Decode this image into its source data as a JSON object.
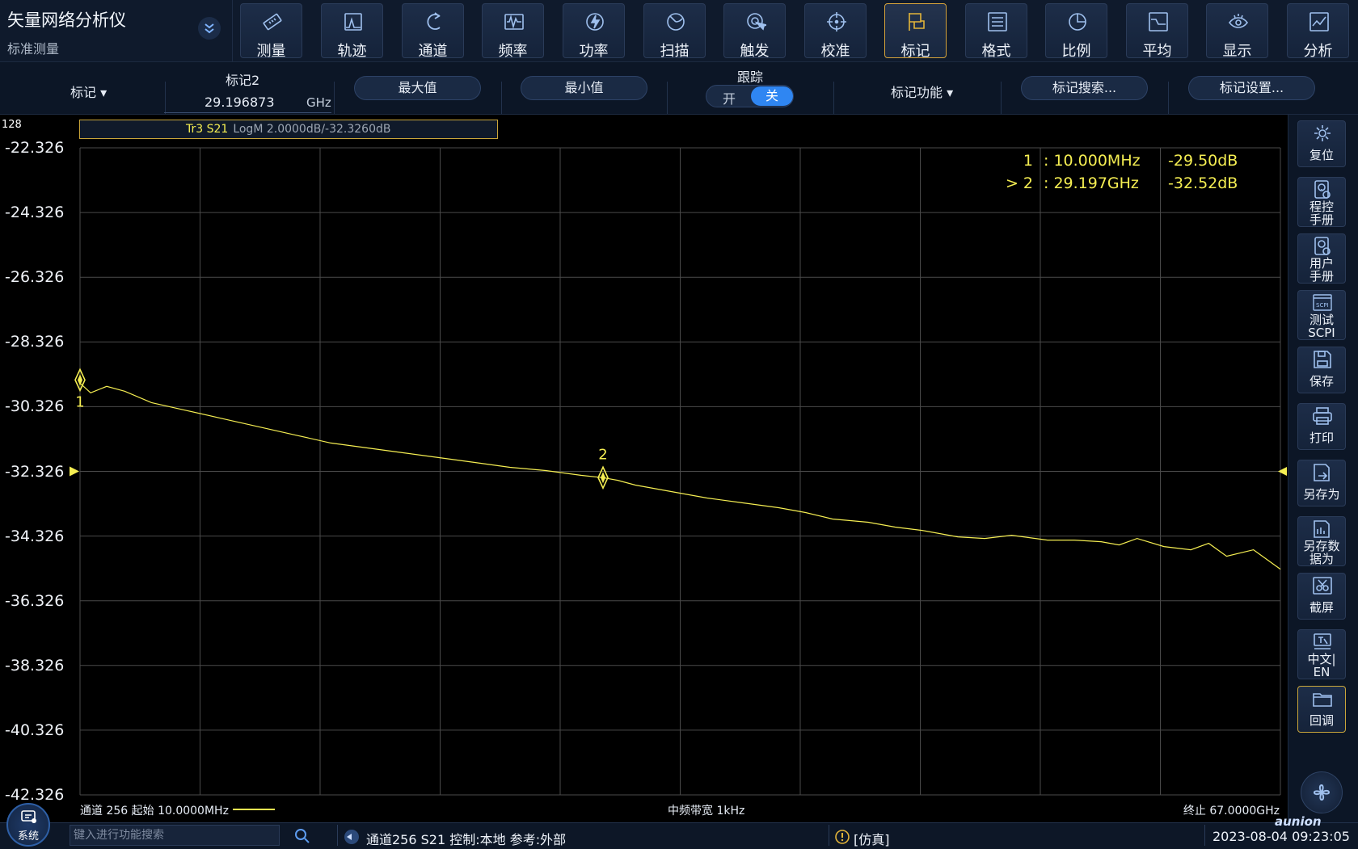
{
  "app": {
    "title": "矢量网络分析仪",
    "subtitle": "标准测量",
    "expand_icon": "double-chevron-down-icon"
  },
  "toolbar": [
    {
      "label": "测量",
      "icon": "ruler-icon"
    },
    {
      "label": "轨迹",
      "icon": "trace-icon"
    },
    {
      "label": "通道",
      "icon": "channel-icon"
    },
    {
      "label": "频率",
      "icon": "frequency-icon"
    },
    {
      "label": "功率",
      "icon": "power-icon"
    },
    {
      "label": "扫描",
      "icon": "sweep-icon"
    },
    {
      "label": "触发",
      "icon": "trigger-icon"
    },
    {
      "label": "校准",
      "icon": "calibration-icon"
    },
    {
      "label": "标记",
      "icon": "marker-flag-icon",
      "active": true
    },
    {
      "label": "格式",
      "icon": "format-icon"
    },
    {
      "label": "比例",
      "icon": "scale-icon"
    },
    {
      "label": "平均",
      "icon": "average-icon"
    },
    {
      "label": "显示",
      "icon": "display-eye-icon"
    },
    {
      "label": "分析",
      "icon": "analysis-icon"
    }
  ],
  "softkeys": {
    "marker_dropdown": "标记",
    "active_marker_label": "标记2",
    "active_marker_value": "29.196873",
    "active_marker_unit": "GHz",
    "max_button": "最大值",
    "min_button": "最小值",
    "tracking_label": "跟踪",
    "tracking_on": "开",
    "tracking_off": "关",
    "marker_function_dropdown": "标记功能",
    "marker_search_button": "标记搜索...",
    "marker_settings_button": "标记设置..."
  },
  "plot": {
    "channel_number": "128",
    "trace_name": "Tr3 S21",
    "trace_info": "LogM 2.0000dB/-32.3260dB",
    "footer_left": "通道 256 起始 10.0000MHz",
    "footer_center": "中频带宽 1kHz",
    "footer_right": "终止 67.0000GHz",
    "marker_table": [
      {
        "id": "1",
        "freq": ": 10.000MHz",
        "value": "-29.50dB"
      },
      {
        "id": "> 2",
        "freq": ": 29.197GHz",
        "value": "-32.52dB"
      }
    ],
    "trace_color": "#f5ee52"
  },
  "chart_data": {
    "type": "line",
    "x_unit": "GHz",
    "xlim": [
      0.01,
      67.0
    ],
    "ylim": [
      -42.326,
      -22.326
    ],
    "y_ticks": [
      "-22.326",
      "-24.326",
      "-26.326",
      "-28.326",
      "-30.326",
      "-32.326",
      "-34.326",
      "-36.326",
      "-38.326",
      "-40.326",
      "-42.326"
    ],
    "reference_level": -32.326,
    "grid": true,
    "series": [
      {
        "name": "Tr3 S21",
        "x": [
          0.01,
          0.6,
          1.5,
          2.5,
          4.0,
          6.0,
          8.0,
          10.0,
          12.0,
          14.0,
          16.0,
          18.0,
          20.0,
          22.0,
          24.0,
          26.0,
          28.0,
          29.197,
          30.0,
          31.0,
          33.0,
          35.0,
          37.0,
          39.0,
          40.5,
          42.0,
          44.0,
          45.5,
          47.0,
          49.0,
          50.5,
          52.0,
          54.0,
          55.5,
          57.0,
          58.0,
          59.0,
          60.5,
          62.0,
          63.0,
          64.0,
          65.5,
          67.0
        ],
        "y": [
          -29.6,
          -29.9,
          -29.7,
          -29.85,
          -30.2,
          -30.45,
          -30.7,
          -30.95,
          -31.2,
          -31.45,
          -31.6,
          -31.75,
          -31.9,
          -32.05,
          -32.2,
          -32.3,
          -32.45,
          -32.52,
          -32.6,
          -32.75,
          -32.95,
          -33.15,
          -33.3,
          -33.45,
          -33.6,
          -33.8,
          -33.9,
          -34.05,
          -34.15,
          -34.35,
          -34.4,
          -34.3,
          -34.45,
          -34.45,
          -34.5,
          -34.6,
          -34.4,
          -34.65,
          -34.75,
          -34.55,
          -34.95,
          -34.75,
          -35.35
        ]
      }
    ],
    "markers": [
      {
        "label": "1",
        "x": 0.01,
        "y": -29.5
      },
      {
        "label": "2",
        "x": 29.197,
        "y": -32.52
      }
    ]
  },
  "right_panel": [
    {
      "label": "复位",
      "icon": "reset-gear-icon"
    },
    {
      "label": "程控\n手册",
      "icon": "programming-manual-icon"
    },
    {
      "label": "用户\n手册",
      "icon": "user-manual-icon"
    },
    {
      "label": "测试\nSCPI",
      "icon": "scpi-test-icon"
    },
    {
      "label": "保存",
      "icon": "save-icon"
    },
    {
      "label": "打印",
      "icon": "print-icon"
    },
    {
      "label": "另存为",
      "icon": "save-as-icon"
    },
    {
      "label": "另存数\n据为",
      "icon": "save-data-as-icon"
    },
    {
      "label": "截屏",
      "icon": "screenshot-icon"
    },
    {
      "label": "中文|\nEN",
      "icon": "language-icon"
    },
    {
      "label": "回调",
      "icon": "recall-folder-icon"
    }
  ],
  "statusbar": {
    "system_label": "系统",
    "search_placeholder": "键入进行功能搜索",
    "channel_status": "通道256 S21 控制:本地 参考:外部",
    "sim_status": "[仿真]",
    "datetime": "2023-08-04 09:23:05",
    "logo": "aunion"
  }
}
